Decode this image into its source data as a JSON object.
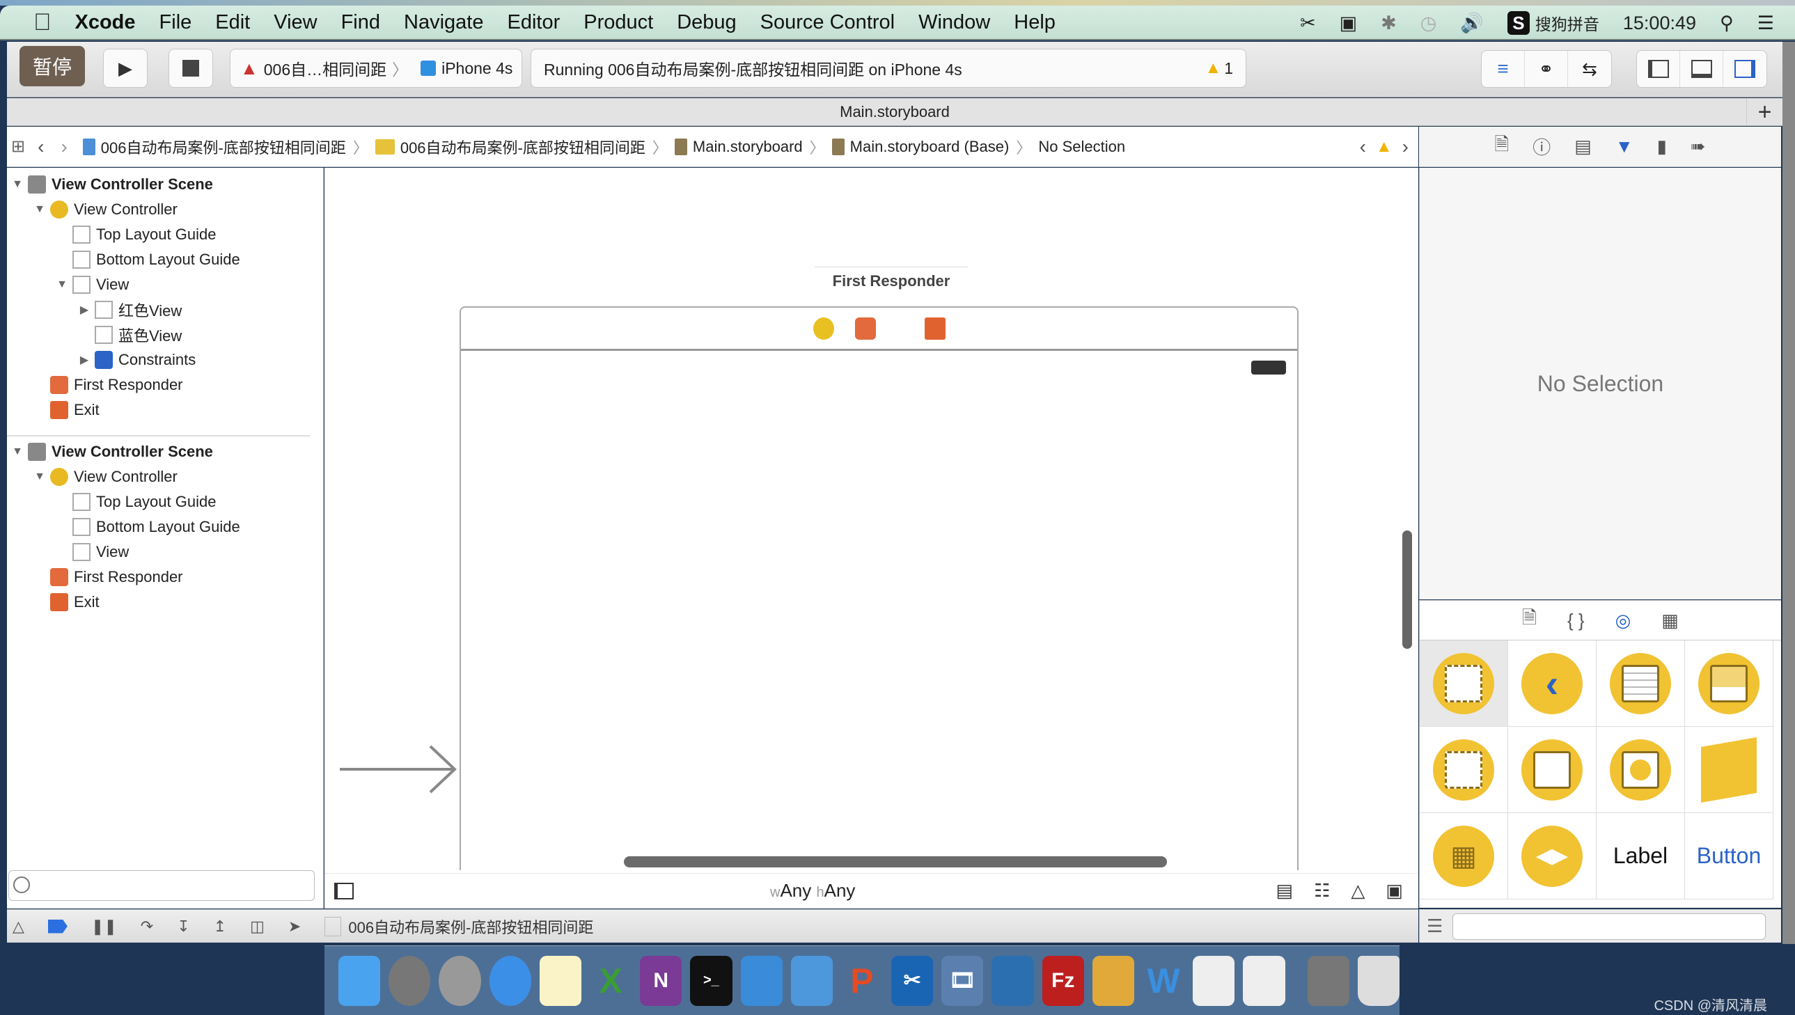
{
  "menubar": {
    "app": "Xcode",
    "items": [
      "File",
      "Edit",
      "View",
      "Find",
      "Navigate",
      "Editor",
      "Product",
      "Debug",
      "Source Control",
      "Window",
      "Help"
    ],
    "input_method": "搜狗拼音",
    "clock": "15:00:49"
  },
  "toolbar": {
    "pause_label": "暂停",
    "scheme": "006自…相同间距",
    "device": "iPhone 4s",
    "activity": "Running 006自动布局案例-底部按钮相同间距 on iPhone 4s",
    "warning_count": "1"
  },
  "tab": {
    "title": "Main.storyboard"
  },
  "jumpbar": {
    "crumbs": [
      "006自动布局案例-底部按钮相同间距",
      "006自动布局案例-底部按钮相同间距",
      "Main.storyboard",
      "Main.storyboard (Base)",
      "No Selection"
    ]
  },
  "navigator": {
    "scene1": {
      "title": "View Controller Scene",
      "vc": "View Controller",
      "top_guide": "Top Layout Guide",
      "bottom_guide": "Bottom Layout Guide",
      "view": "View",
      "red_view": "红色View",
      "blue_view": "蓝色View",
      "constraints": "Constraints",
      "first_responder": "First Responder",
      "exit": "Exit"
    },
    "scene2": {
      "title": "View Controller Scene",
      "vc": "View Controller",
      "top_guide": "Top Layout Guide",
      "bottom_guide": "Bottom Layout Guide",
      "view": "View",
      "first_responder": "First Responder",
      "exit": "Exit"
    }
  },
  "canvas": {
    "scene_title": "First Responder",
    "size_w": "Any",
    "size_h": "Any",
    "w_prefix": "w",
    "h_prefix": "h"
  },
  "debugbar": {
    "target": "006自动布局案例-底部按钮相同间距"
  },
  "inspector": {
    "empty_text": "No Selection"
  },
  "library": {
    "label_item": "Label",
    "button_item": "Button"
  },
  "watermark": "CSDN @清风清晨",
  "colors": {
    "accent": "#2b63c6",
    "object_yellow": "#f1c232",
    "pause_bg": "#6e5f51"
  }
}
